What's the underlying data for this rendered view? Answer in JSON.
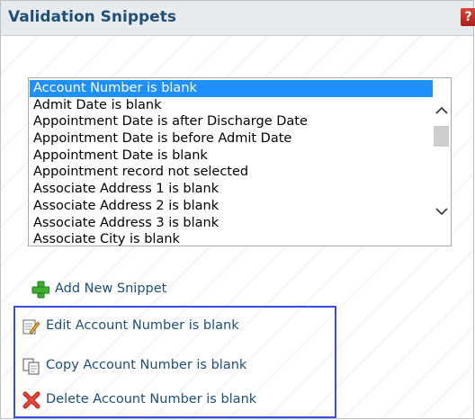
{
  "header": {
    "title": "Validation Snippets",
    "help_icon": "?"
  },
  "snippet_list": {
    "items": [
      "Account Number is blank",
      "Admit Date is blank",
      "Appointment Date is after Discharge Date",
      "Appointment Date is before Admit Date",
      "Appointment Date is blank",
      "Appointment record not selected",
      "Associate Address 1 is blank",
      "Associate Address 2 is blank",
      "Associate Address 3 is blank",
      "Associate City is blank"
    ],
    "selected_index": 0,
    "scroll_up_glyph": "^",
    "scroll_down_glyph": "∨"
  },
  "actions": {
    "add": {
      "label": "Add New Snippet",
      "icon": "plus-icon"
    },
    "edit": {
      "label": "Edit Account Number is blank",
      "icon": "edit-icon"
    },
    "copy": {
      "label": "Copy Account Number is blank",
      "icon": "copy-icon"
    },
    "delete": {
      "label": "Delete Account Number is blank",
      "icon": "delete-icon"
    }
  },
  "colors": {
    "title": "#1f4e79",
    "selection": "#1e90ff",
    "link": "#1f4e79",
    "highlight_border": "#3a4fe0"
  }
}
